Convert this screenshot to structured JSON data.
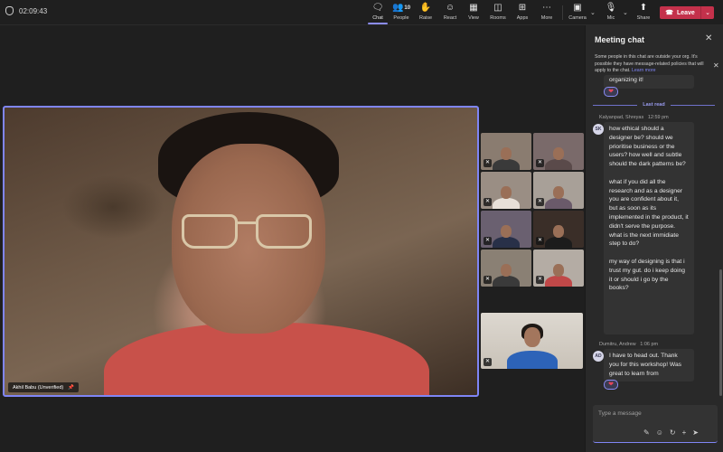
{
  "meeting": {
    "timer": "02:09:43"
  },
  "toolbar": {
    "chat": "Chat",
    "people": "People",
    "people_count": "10",
    "raise": "Raise",
    "react": "React",
    "view": "View",
    "rooms": "Rooms",
    "apps": "Apps",
    "more": "More",
    "camera": "Camera",
    "mic": "Mic",
    "share": "Share",
    "leave": "Leave"
  },
  "stage": {
    "main_participant": "Akhil Babu (Unverified)",
    "tile_count": 10
  },
  "chat": {
    "title": "Meeting chat",
    "notice": "Some people in this chat are outside your org. It's possible they have message-related policies that will apply to the chat.",
    "notice_link": "Learn more",
    "prev_message_tail": "organizing it!",
    "last_read": "Last read",
    "messages": [
      {
        "sender": "Kalyanpad, Shreyas",
        "time": "12:59 pm",
        "initials": "SK",
        "paragraphs": [
          "how ethical should a designer be? should we prioritise business or the users? how well and subtle should the dark patterns be?",
          "what if you did all the research and as a designer you are confident about it, but as soon as its implemented in the product, it didn't serve the purpose. what is the next immidiate step to do?",
          "my way of designing is that i trust my gut. do i keep doing it or should i go by the books?"
        ]
      },
      {
        "sender": "Dumitru, Andrew",
        "time": "1:06 pm",
        "initials": "AD",
        "paragraphs": [
          "I have to head out. Thank you for this workshop! Was great to learn from"
        ]
      }
    ],
    "compose_placeholder": "Type a message"
  },
  "colors": {
    "accent": "#7f85f5",
    "leave": "#c4314b",
    "heart": "#e9465b"
  }
}
